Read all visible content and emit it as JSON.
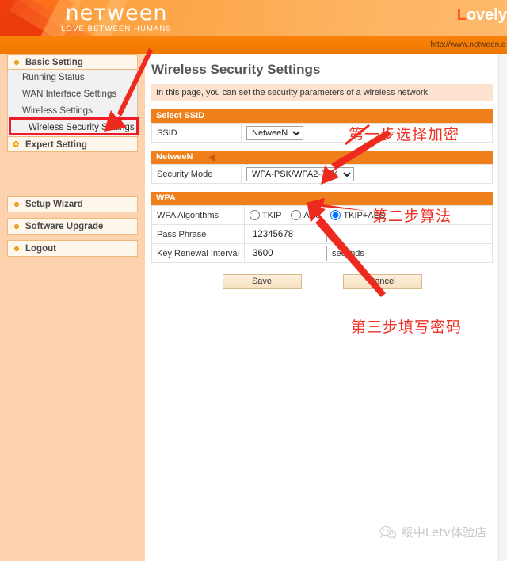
{
  "header": {
    "logo_word": "neтween",
    "logo_tagline": "LOVE BETWEEN HUMANS",
    "brand_right": "ovely",
    "brand_right_cap": "L",
    "url": "http://www.netween.c",
    "colors": {
      "header_orange": "#fca241",
      "band_orange": "#f07800",
      "section_orange": "#ef7f1a",
      "sidebar_peach": "#fdd2ae",
      "annotation_red": "#ef3124",
      "highlight_red": "#ee1c25"
    }
  },
  "sidebar": {
    "groups": [
      {
        "label": "Basic Setting",
        "icon": "bullet-icon",
        "items": [
          {
            "label": "Running Status",
            "selected": false
          },
          {
            "label": "WAN Interface Settings",
            "selected": false
          },
          {
            "label": "Wireless Settings",
            "selected": false
          },
          {
            "label": "Wireless Security Settings",
            "selected": true
          }
        ]
      }
    ],
    "expert": {
      "label": "Expert Setting",
      "icon": "flower-icon"
    },
    "singles": [
      {
        "label": "Setup Wizard",
        "icon": "bullet-icon"
      },
      {
        "label": "Software Upgrade",
        "icon": "bullet-icon"
      },
      {
        "label": "Logout",
        "icon": "bullet-icon"
      }
    ]
  },
  "main": {
    "title": "Wireless Security Settings",
    "description": "In this page, you can set the security parameters of a wireless network.",
    "select_ssid": {
      "section_label": "Select SSID",
      "ssid_label": "SSID",
      "ssid_value": "NetweeN",
      "ssid_options": [
        "NetweeN"
      ]
    },
    "ssid_section": {
      "section_label": "NetweeN",
      "security_mode_label": "Security Mode",
      "security_mode_value": "WPA-PSK/WPA2-PSK",
      "security_mode_options": [
        "WPA-PSK/WPA2-PSK"
      ]
    },
    "wpa": {
      "section_label": "WPA",
      "algorithms_label": "WPA Algorithms",
      "algorithms": [
        {
          "label": "TKIP",
          "checked": false
        },
        {
          "label": "AES",
          "checked": false
        },
        {
          "label": "TKIP+AES",
          "checked": true
        }
      ],
      "pass_phrase_label": "Pass Phrase",
      "pass_phrase_value": "12345678",
      "key_renewal_label": "Key Renewal Interval",
      "key_renewal_value": "3600",
      "key_renewal_unit": "seconds"
    },
    "buttons": {
      "save": "Save",
      "cancel": "Cancel"
    }
  },
  "annotations": [
    {
      "id": "step1",
      "text": "第一步选择加密"
    },
    {
      "id": "step2",
      "text": "第二步算法"
    },
    {
      "id": "step3",
      "text": "第三步填写密码"
    }
  ],
  "watermark": {
    "icon": "wechat-icon",
    "text": "绥中Letv体验店"
  }
}
